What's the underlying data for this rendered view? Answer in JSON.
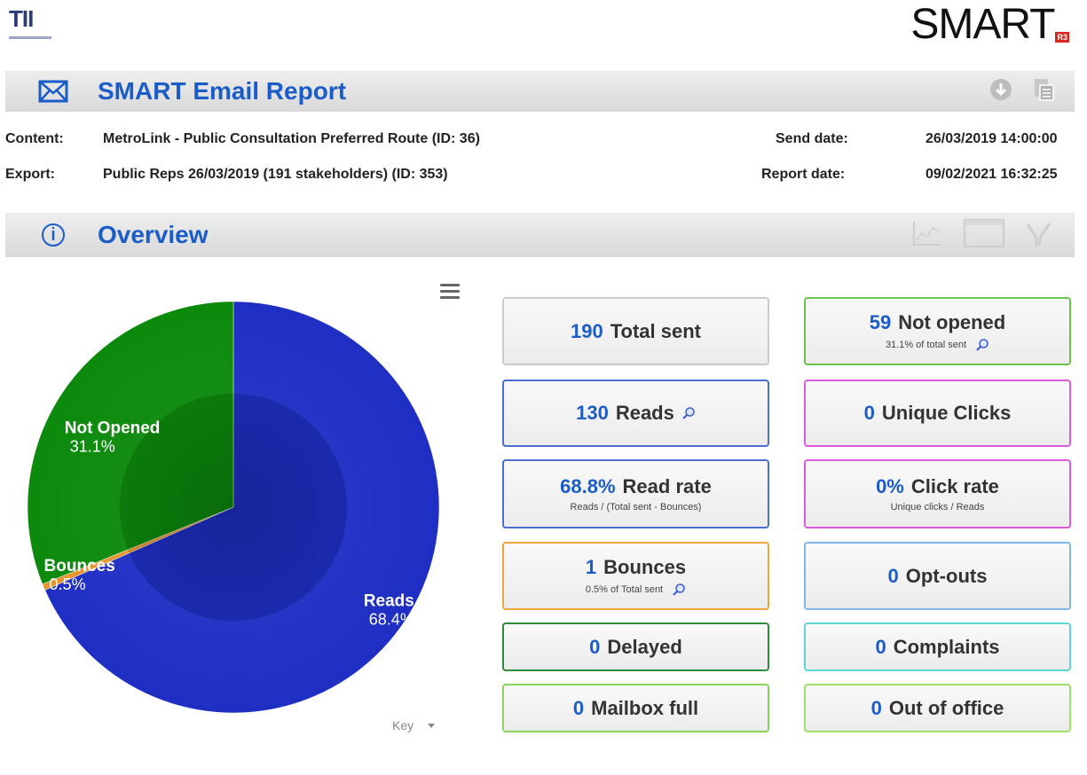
{
  "brand": {
    "left_logo": "TII",
    "right_logo": "SMART",
    "right_logo_sub": "R3"
  },
  "header": {
    "title": "SMART Email Report",
    "icon": "envelope-icon",
    "actions": [
      "download-icon",
      "document-icon"
    ]
  },
  "meta": {
    "content_label": "Content:",
    "content_value": "MetroLink - Public Consultation Preferred Route (ID: 36)",
    "export_label": "Export:",
    "export_value": "Public Reps 26/03/2019 (191 stakeholders) (ID: 353)",
    "send_date_label": "Send date:",
    "send_date_value": "26/03/2019 14:00:00",
    "report_date_label": "Report date:",
    "report_date_value": "09/02/2021 16:32:25"
  },
  "overview": {
    "title": "Overview",
    "icon": "info-icon",
    "actions": [
      "line-chart-icon",
      "window-icon",
      "funnel-icon"
    ]
  },
  "chart_data": {
    "type": "pie",
    "slices": [
      {
        "label": "Reads",
        "value": 68.4,
        "display": "68.4%",
        "color": "#1f2fc4"
      },
      {
        "label": "Not Opened",
        "value": 31.1,
        "display": "31.1%",
        "color": "#0c8a0c"
      },
      {
        "label": "Bounces",
        "value": 0.5,
        "display": "0.5%",
        "color": "#e8932d"
      }
    ],
    "legend_toggle": "Key"
  },
  "stats": {
    "total_sent": {
      "num": "190",
      "label": "Total sent",
      "border": "#cccccc"
    },
    "reads": {
      "num": "130",
      "label": "Reads",
      "border": "#4a6fd1"
    },
    "read_rate": {
      "num": "68.8%",
      "label": "Read rate",
      "sub": "Reads / (Total sent - Bounces)",
      "border": "#4a6fd1"
    },
    "bounces": {
      "num": "1",
      "label": "Bounces",
      "sub": "0.5% of Total sent",
      "border": "#f0a63c"
    },
    "delayed": {
      "num": "0",
      "label": "Delayed",
      "border": "#2e8b3a"
    },
    "mailbox_full": {
      "num": "0",
      "label": "Mailbox full",
      "border": "#8ad35a"
    },
    "not_opened": {
      "num": "59",
      "label": "Not opened",
      "sub": "31.1% of total sent",
      "border": "#6cc24a"
    },
    "unique_clicks": {
      "num": "0",
      "label": "Unique Clicks",
      "border": "#e05ae0"
    },
    "click_rate": {
      "num": "0%",
      "label": "Click rate",
      "sub": "Unique clicks / Reads",
      "border": "#e05ae0"
    },
    "opt_outs": {
      "num": "0",
      "label": "Opt-outs",
      "border": "#7fb8e6"
    },
    "complaints": {
      "num": "0",
      "label": "Complaints",
      "border": "#5fd6d6"
    },
    "out_of_office": {
      "num": "0",
      "label": "Out of office",
      "border": "#9ee06a"
    }
  }
}
